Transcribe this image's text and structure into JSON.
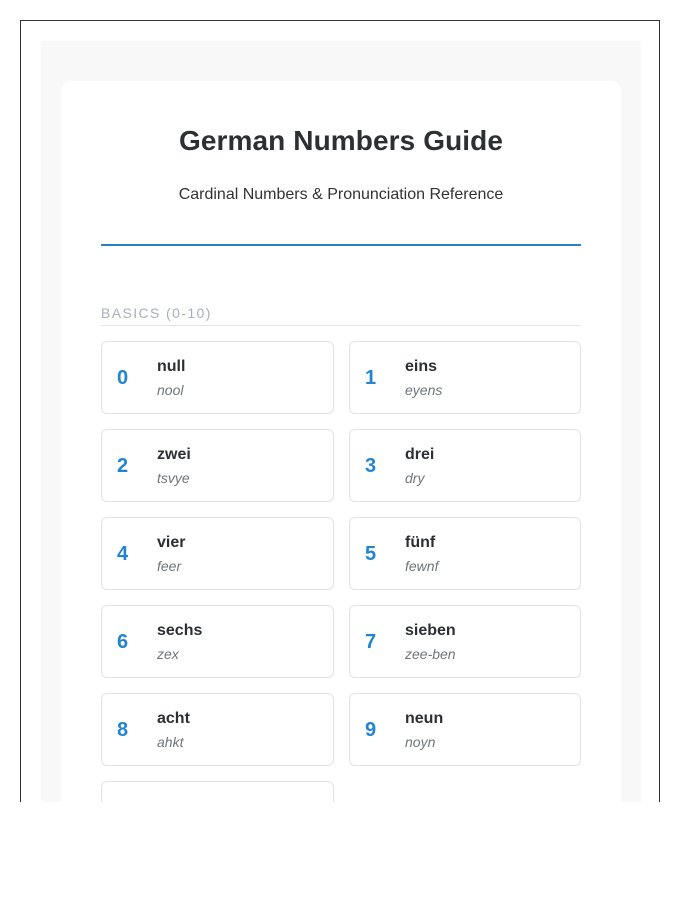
{
  "header": {
    "title": "German Numbers Guide",
    "subtitle": "Cardinal Numbers & Pronunciation Reference"
  },
  "section": {
    "title": "BASICS (0-10)"
  },
  "numbers": [
    {
      "digit": "0",
      "word": "null",
      "pronunciation": "nool"
    },
    {
      "digit": "1",
      "word": "eins",
      "pronunciation": "eyens"
    },
    {
      "digit": "2",
      "word": "zwei",
      "pronunciation": "tsvye"
    },
    {
      "digit": "3",
      "word": "drei",
      "pronunciation": "dry"
    },
    {
      "digit": "4",
      "word": "vier",
      "pronunciation": "feer"
    },
    {
      "digit": "5",
      "word": "fünf",
      "pronunciation": "fewnf"
    },
    {
      "digit": "6",
      "word": "sechs",
      "pronunciation": "zex"
    },
    {
      "digit": "7",
      "word": "sieben",
      "pronunciation": "zee-ben"
    },
    {
      "digit": "8",
      "word": "acht",
      "pronunciation": "ahkt"
    },
    {
      "digit": "9",
      "word": "neun",
      "pronunciation": "noyn"
    }
  ],
  "colors": {
    "accent": "#2384cf",
    "rule": "#2b7fc4",
    "text": "#2c2f33",
    "muted": "#6f757b",
    "border": "#dfe3e7"
  }
}
